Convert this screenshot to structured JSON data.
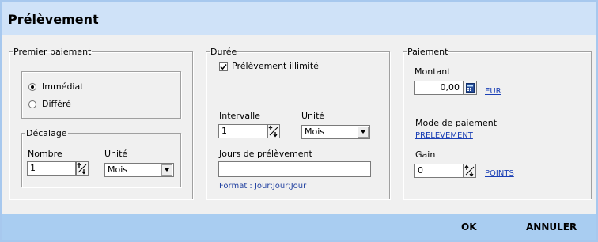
{
  "title": "Prélèvement",
  "premier_paiement": {
    "legend": "Premier paiement",
    "radio_immediat": "Immédiat",
    "radio_differe": "Différé",
    "selected": "Immédiat",
    "decalage": {
      "legend": "Décalage",
      "nombre_label": "Nombre",
      "nombre_value": "1",
      "unite_label": "Unité",
      "unite_value": "Mois"
    }
  },
  "duree": {
    "legend": "Durée",
    "illimite_label": "Prélèvement illimité",
    "illimite_checked": true,
    "intervalle_label": "Intervalle",
    "intervalle_value": "1",
    "unite_label": "Unité",
    "unite_value": "Mois",
    "jours_label": "Jours de prélèvement",
    "jours_value": "",
    "format_hint": "Format : Jour;Jour;Jour"
  },
  "paiement": {
    "legend": "Paiement",
    "montant_label": "Montant",
    "montant_value": "0,00",
    "currency_link": "EUR",
    "mode_label": "Mode de paiement",
    "mode_link": "PRELEVEMENT",
    "gain_label": "Gain",
    "gain_value": "0",
    "gain_link": "POINTS"
  },
  "footer": {
    "ok": "OK",
    "cancel": "ANNULER"
  },
  "icons": {
    "spin": "spinner-arrows-icon",
    "calculator": "calculator-icon",
    "dropdown": "chevron-down-icon",
    "check": "checkmark-icon"
  },
  "colors": {
    "title_bar": "#cfe2f8",
    "footer_bar": "#a9cdf1",
    "link": "#1a3fb5"
  }
}
